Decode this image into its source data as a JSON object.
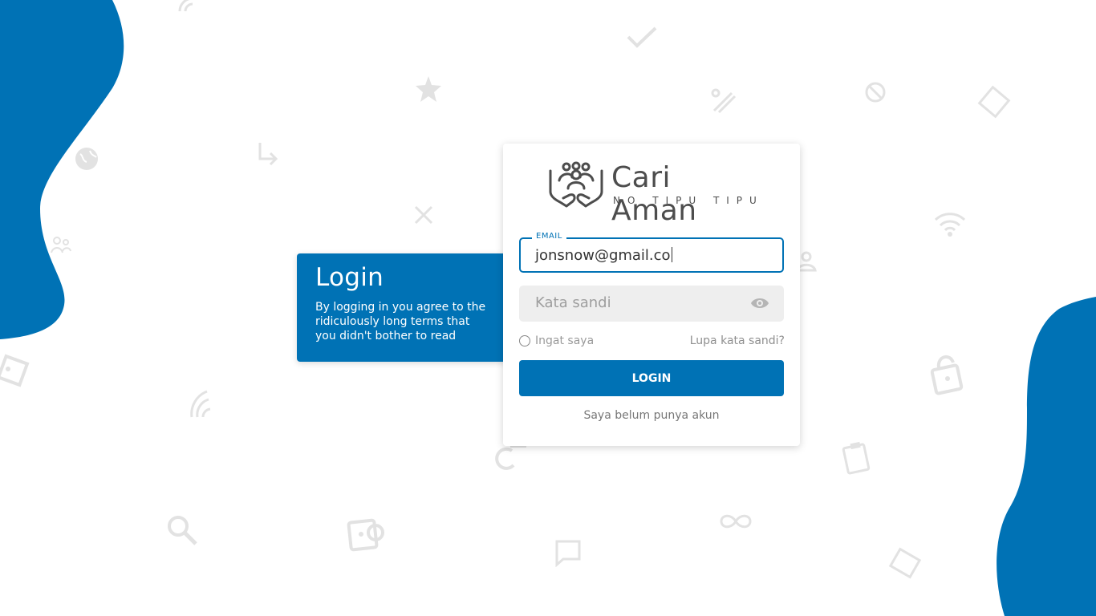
{
  "colors": {
    "accent": "#0072b5",
    "background": "#ffffff",
    "icon_gray": "#e2e2e2"
  },
  "info_panel": {
    "title": "Login",
    "text": "By logging in you agree to the ridiculously long terms that you didn't bother to read"
  },
  "logo": {
    "name": "Cari Aman",
    "tagline": "NO TIPU TIPU",
    "icon": "people-in-hands-icon"
  },
  "form": {
    "email_label": "EMAIL",
    "email_value": "jonsnow@gmail.co",
    "password_placeholder": "Kata sandi",
    "password_icon": "eye-icon",
    "remember_label": "Ingat saya",
    "forgot_label": "Lupa kata sandi?",
    "login_label": "LOGIN",
    "register_label": "Saya belum punya akun"
  },
  "background_icons": [
    "wifi-icon",
    "checkmark-icon",
    "star-icon",
    "pencil-ruler-icon",
    "blocked-icon",
    "tag-icon",
    "globe-icon",
    "arrow-return-icon",
    "close-icon",
    "wifi-icon",
    "group-icon",
    "user-icon",
    "tag-icon",
    "lock-icon",
    "signal-icon",
    "refresh-icon",
    "clipboard-icon",
    "search-icon",
    "camera-icon",
    "chat-icon",
    "infinity-icon",
    "tag-icon"
  ]
}
